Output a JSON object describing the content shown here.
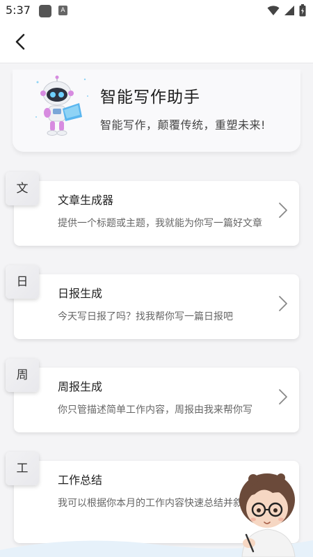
{
  "status_bar": {
    "time": "5:37"
  },
  "header": {
    "title": "智能写作助手",
    "subtitle": "智能写作，颠覆传统，重塑未来!"
  },
  "cards": [
    {
      "badge": "文",
      "title": "文章生成器",
      "desc": "提供一个标题或主题，我就能为你写一篇好文章"
    },
    {
      "badge": "日",
      "title": "日报生成",
      "desc": "今天写日报了吗？找我帮你写一篇日报吧"
    },
    {
      "badge": "周",
      "title": "周报生成",
      "desc": "你只管描述简单工作内容，周报由我来帮你写"
    },
    {
      "badge": "工",
      "title": "工作总结",
      "desc": "我可以根据你本月的工作内容快速总结并叙述"
    }
  ],
  "colors": {
    "card_bg": "#ffffff",
    "page_bg": "#f4f4f6",
    "accent": "#59b5f0"
  },
  "icons": {
    "back": "back-arrow-icon",
    "chevron": "chevron-right-icon",
    "wifi": "wifi-icon",
    "signal": "signal-icon",
    "battery": "battery-icon"
  }
}
